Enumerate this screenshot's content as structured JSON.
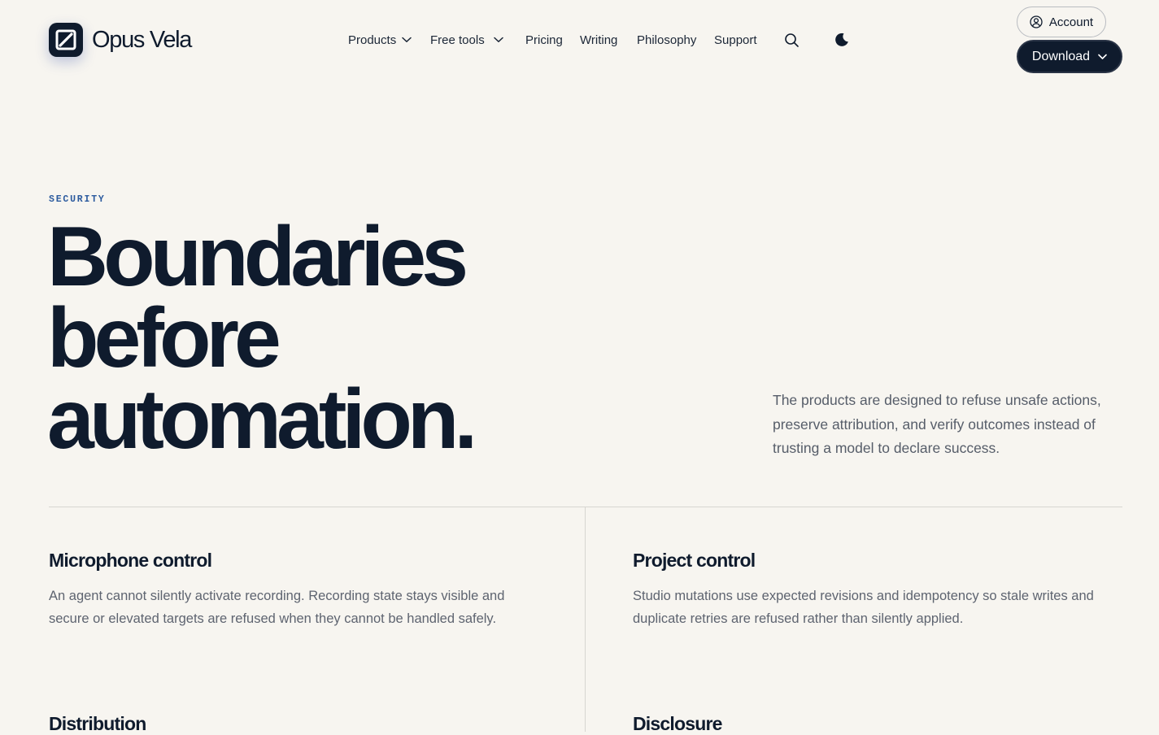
{
  "brand": {
    "name": "Opus Vela",
    "logo_icon": "slash-square-logo"
  },
  "nav": {
    "items": [
      {
        "label": "Products",
        "has_dropdown": true
      },
      {
        "label": "Free tools",
        "has_dropdown": true
      },
      {
        "label": "Pricing",
        "has_dropdown": false
      },
      {
        "label": "Writing",
        "has_dropdown": false
      },
      {
        "label": "Philosophy",
        "has_dropdown": false
      },
      {
        "label": "Support",
        "has_dropdown": false
      }
    ],
    "search_icon": "search-icon",
    "theme_icon": "moon-icon"
  },
  "actions": {
    "account_label": "Account",
    "account_icon": "user-circle-icon",
    "download_label": "Download"
  },
  "hero": {
    "eyebrow": "SECURITY",
    "title_lines": [
      "Boundaries",
      "before",
      "automation."
    ],
    "description": "The products are designed to refuse unsafe actions, preserve attribution, and verify outcomes instead of trusting a model to declare success."
  },
  "features": [
    {
      "title": "Microphone control",
      "description": "An agent cannot silently activate recording. Recording state stays visible and secure or elevated targets are refused when they cannot be handled safely."
    },
    {
      "title": "Project control",
      "description": "Studio mutations use expected revisions and idempotency so stale writes and duplicate retries are refused rather than silently applied."
    },
    {
      "title": "Distribution",
      "description": ""
    },
    {
      "title": "Disclosure",
      "description": ""
    }
  ],
  "colors": {
    "background": "#f7f5f0",
    "ink": "#0f1b2d",
    "accent": "#2b5a9e",
    "muted_text": "#565d69",
    "divider": "#d7d6d1"
  }
}
